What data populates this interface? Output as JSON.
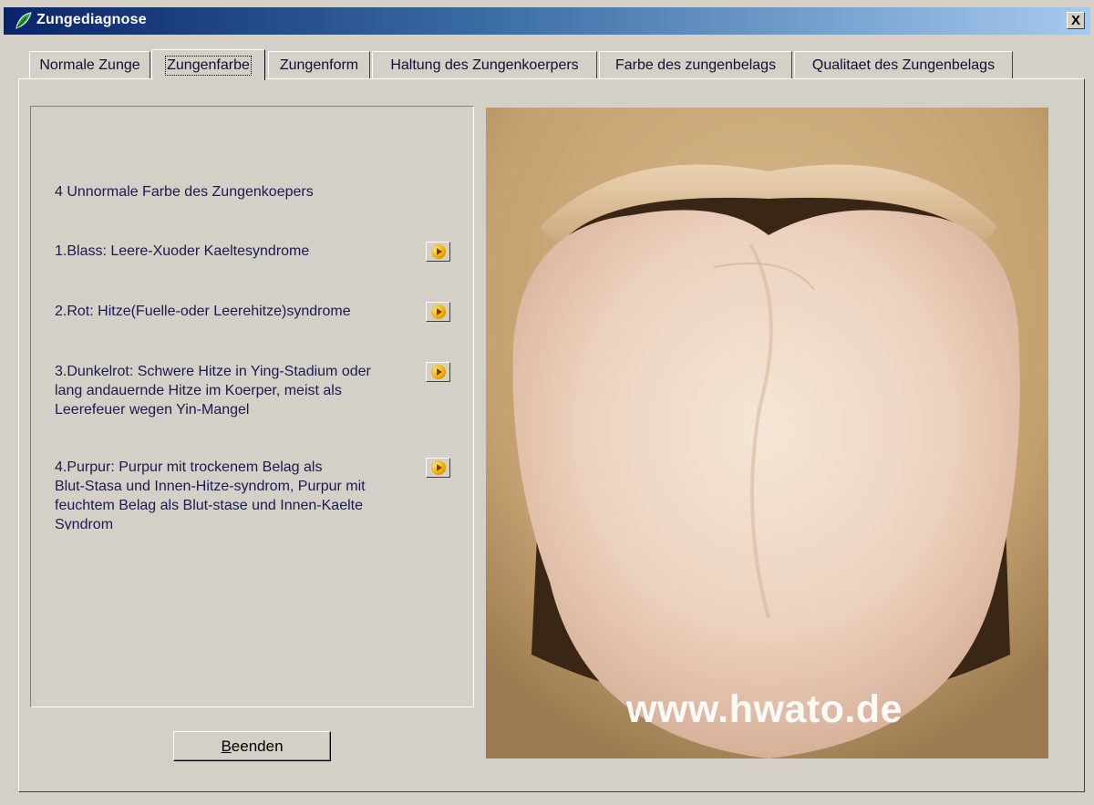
{
  "window": {
    "title": "Zungediagnose",
    "close_label": "X"
  },
  "tabs": [
    {
      "label": "Normale Zunge",
      "active": false
    },
    {
      "label": "Zungenfarbe",
      "active": true
    },
    {
      "label": "Zungenform",
      "active": false
    },
    {
      "label": "Haltung des Zungenkoerpers",
      "active": false
    },
    {
      "label": "Farbe des zungenbelags",
      "active": false
    },
    {
      "label": "Qualitaet des Zungenbelags",
      "active": false
    }
  ],
  "content": {
    "heading": "4 Unnormale Farbe des Zungenkoepers",
    "items": [
      {
        "lines": [
          "1.Blass: Leere-Xuoder Kaeltesyndrome"
        ]
      },
      {
        "lines": [
          "2.Rot: Hitze(Fuelle-oder Leerehitze)syndrome"
        ]
      },
      {
        "lines": [
          "3.Dunkelrot: Schwere Hitze in Ying-Stadium oder",
          "lang andauernde Hitze im Koerper, meist als",
          "Leerefeuer wegen Yin-Mangel"
        ]
      },
      {
        "lines": [
          "4.Purpur: Purpur mit trockenem Belag als",
          "Blut-Stasa und Innen-Hitze-syndrom, Purpur mit",
          "feuchtem Belag als Blut-stase und Innen-Kaelte",
          "Syndrom"
        ]
      }
    ]
  },
  "buttons": {
    "quit_first": "B",
    "quit_rest": "eenden"
  },
  "image": {
    "watermark": "www.hwato.de"
  }
}
